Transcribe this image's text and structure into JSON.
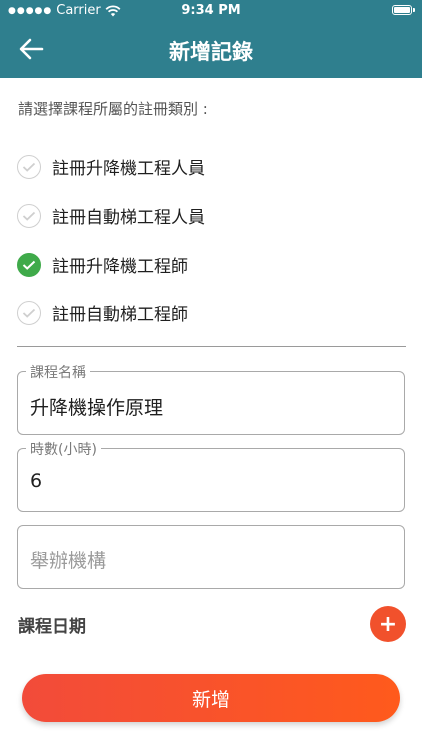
{
  "statusbar": {
    "carrier": "Carrier",
    "time": "9:34 PM"
  },
  "header": {
    "title": "新增記錄",
    "back_icon": "arrow-left-icon"
  },
  "prompt": "請選擇課程所屬的註冊類別 :",
  "categories": [
    {
      "label": "註冊升降機工程人員",
      "checked": false
    },
    {
      "label": "註冊自動梯工程人員",
      "checked": false
    },
    {
      "label": "註冊升降機工程師",
      "checked": true
    },
    {
      "label": "註冊自動梯工程師",
      "checked": false
    }
  ],
  "fields": {
    "course_name": {
      "label": "課程名稱",
      "value": "升降機操作原理"
    },
    "hours": {
      "label": "時數(小時)",
      "value": "6"
    },
    "organizer": {
      "placeholder": "舉辦機構"
    }
  },
  "course_date": {
    "label": "課程日期",
    "add_icon": "+"
  },
  "submit_label": "新增",
  "colors": {
    "header": "#2f7f8e",
    "checked": "#3faa4a",
    "accent": "#f1512c"
  }
}
